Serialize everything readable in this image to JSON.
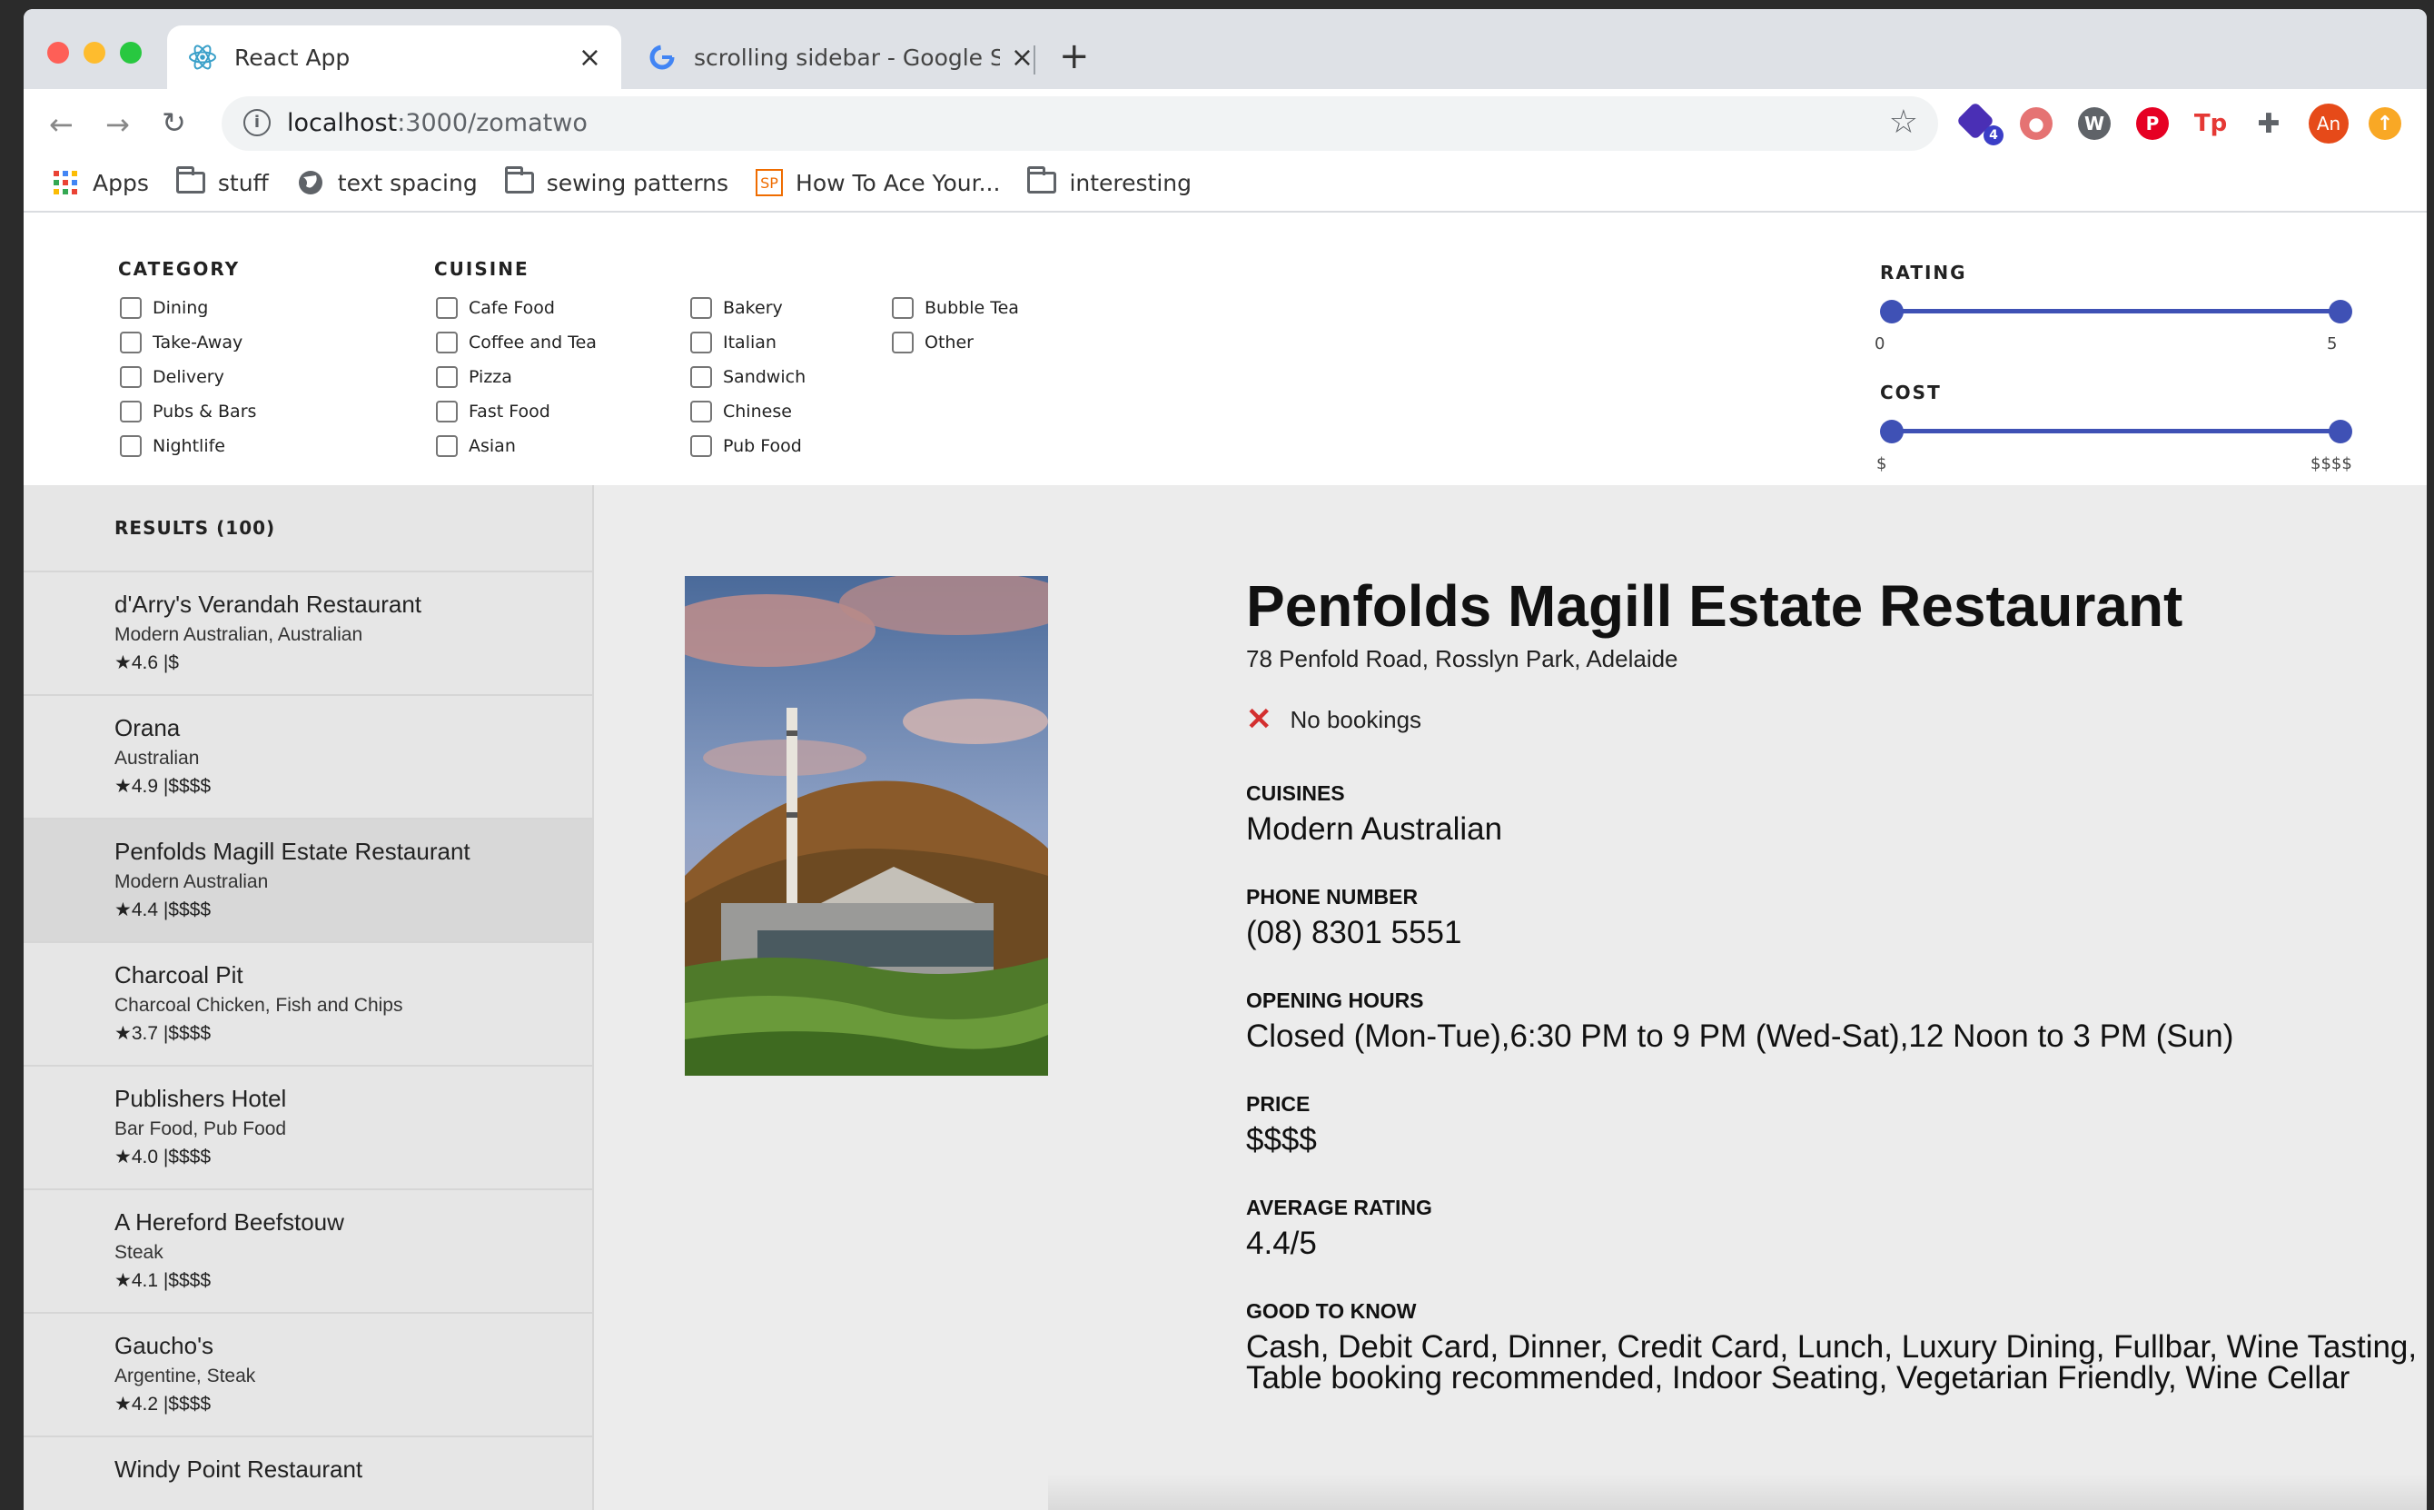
{
  "browser": {
    "tabs": [
      {
        "title": "React App",
        "close": "×"
      },
      {
        "title": "scrolling sidebar - Google Sear",
        "close": "×"
      }
    ],
    "new_tab": "+",
    "url_host": "localhost",
    "url_rest": ":3000/zomatwo",
    "profile_initials": "An",
    "extension_badge": "4"
  },
  "bookmarks": [
    "Apps",
    "stuff",
    "text spacing",
    "sewing patterns",
    "How To Ace Your...",
    "interesting"
  ],
  "bookmark_sp_label": "SP",
  "filters": {
    "category_title": "CATEGORY",
    "categories": [
      "Dining",
      "Take-Away",
      "Delivery",
      "Pubs & Bars",
      "Nightlife"
    ],
    "cuisine_title": "CUISINE",
    "cuisines_col1": [
      "Cafe Food",
      "Coffee and Tea",
      "Pizza",
      "Fast Food",
      "Asian"
    ],
    "cuisines_col2": [
      "Bakery",
      "Italian",
      "Sandwich",
      "Chinese",
      "Pub Food"
    ],
    "cuisines_col3": [
      "Bubble Tea",
      "Other"
    ],
    "rating": {
      "title": "RATING",
      "min_label": "0",
      "max_label": "5",
      "range": [
        0,
        5
      ]
    },
    "cost": {
      "title": "COST",
      "min_label": "$",
      "max_label": "$$$$",
      "range": [
        1,
        4
      ]
    }
  },
  "results": {
    "header": "RESULTS (100)",
    "items": [
      {
        "name": "d'Arry's Verandah Restaurant",
        "cuisine": "Modern Australian, Australian",
        "meta": "4.6 |$"
      },
      {
        "name": "Orana",
        "cuisine": "Australian",
        "meta": "4.9 |$$$$"
      },
      {
        "name": "Penfolds Magill Estate Restaurant",
        "cuisine": "Modern Australian",
        "meta": "4.4 |$$$$"
      },
      {
        "name": "Charcoal Pit",
        "cuisine": "Charcoal Chicken, Fish and Chips",
        "meta": "3.7 |$$$$"
      },
      {
        "name": "Publishers Hotel",
        "cuisine": "Bar Food, Pub Food",
        "meta": "4.0 |$$$$"
      },
      {
        "name": "A Hereford Beefstouw",
        "cuisine": "Steak",
        "meta": "4.1 |$$$$"
      },
      {
        "name": "Gaucho's",
        "cuisine": "Argentine, Steak",
        "meta": "4.2 |$$$$"
      },
      {
        "name": "Windy Point Restaurant",
        "cuisine": "",
        "meta": ""
      }
    ]
  },
  "detail": {
    "name": "Penfolds Magill Estate Restaurant",
    "address": "78 Penfold Road, Rosslyn Park, Adelaide",
    "booking_icon": "✕",
    "booking": "No bookings",
    "cuisines_label": "CUISINES",
    "cuisines": "Modern Australian",
    "phone_label": "PHONE NUMBER",
    "phone": "(08) 8301 5551",
    "hours_label": "OPENING HOURS",
    "hours": "Closed (Mon-Tue),6:30 PM to 9 PM (Wed-Sat),12 Noon to 3 PM (Sun)",
    "price_label": "PRICE",
    "price": "$$$$",
    "rating_label": "AVERAGE RATING",
    "rating": "4.4/5",
    "good_label": "GOOD TO KNOW",
    "good": "Cash, Debit Card, Dinner, Credit Card, Lunch, Luxury Dining, Fullbar, Wine Tasting, Table booking recommended, Indoor Seating, Vegetarian Friendly, Wine Cellar"
  },
  "colors": {
    "accent": "#3f51b5",
    "no_booking": "#d32f2f",
    "selected_row": "#d8d8d8"
  }
}
